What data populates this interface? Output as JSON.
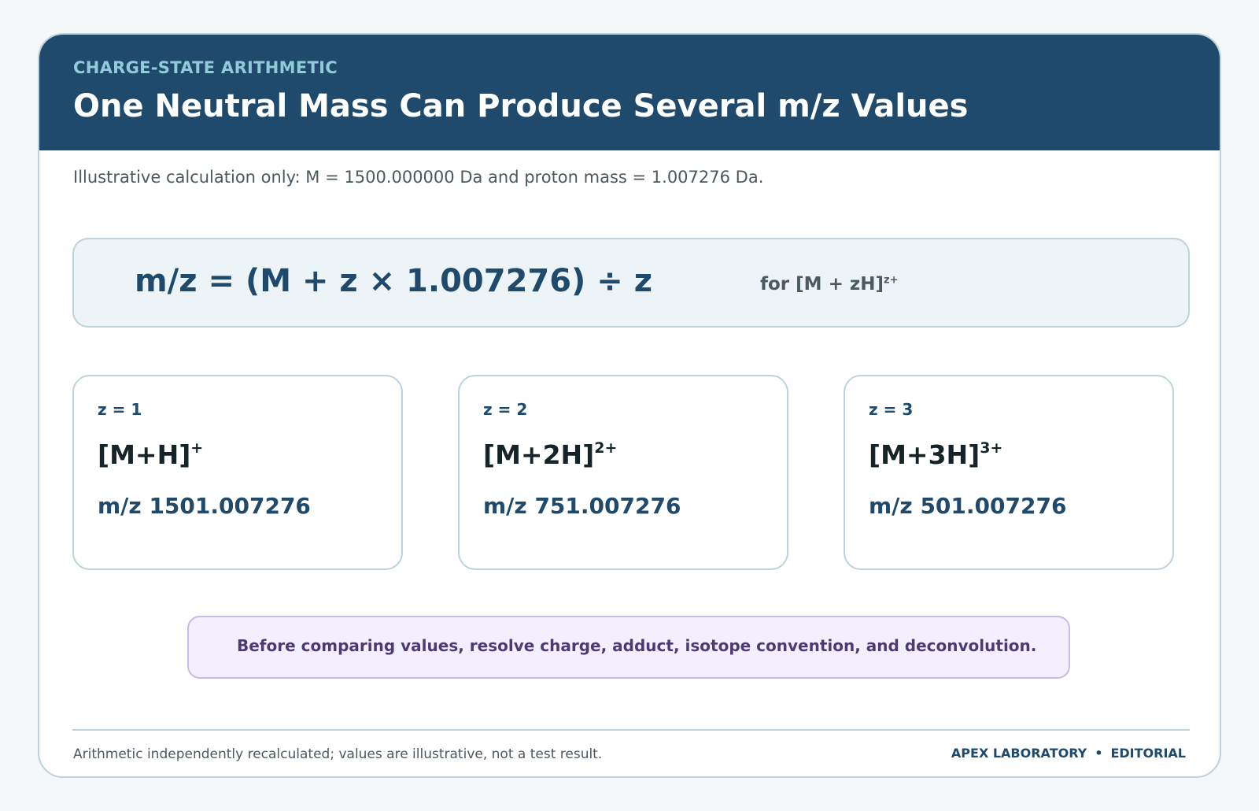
{
  "header": {
    "kicker": "CHARGE-STATE ARITHMETIC",
    "title": "One Neutral Mass Can Produce Several m/z Values"
  },
  "subtitle": "Illustrative calculation only: M = 1500.000000 Da and proton mass = 1.007276 Da.",
  "formula": {
    "expression": "m/z = (M + z × 1.007276) ÷ z",
    "note_prefix": "for [M + zH]",
    "note_sup": "z+"
  },
  "tiles": [
    {
      "z_label": "z = 1",
      "ion": "[M+H]",
      "ion_sup": "+",
      "mz": "m/z 1501.007276"
    },
    {
      "z_label": "z = 2",
      "ion": "[M+2H]",
      "ion_sup": "2+",
      "mz": "m/z 751.007276"
    },
    {
      "z_label": "z = 3",
      "ion": "[M+3H]",
      "ion_sup": "3+",
      "mz": "m/z 501.007276"
    }
  ],
  "callout": "Before comparing values, resolve charge, adduct, isotope convention, and deconvolution.",
  "footer": {
    "note": "Arithmetic independently recalculated; values are illustrative, not a test result.",
    "org": "APEX LABORATORY",
    "separator": "•",
    "section": "EDITORIAL"
  },
  "colors": {
    "header_bg": "#1f4a6b",
    "kicker": "#8fcbd9",
    "accent": "#1f4a6b",
    "callout_bg": "#f3efff",
    "callout_text": "#4e3a73"
  }
}
